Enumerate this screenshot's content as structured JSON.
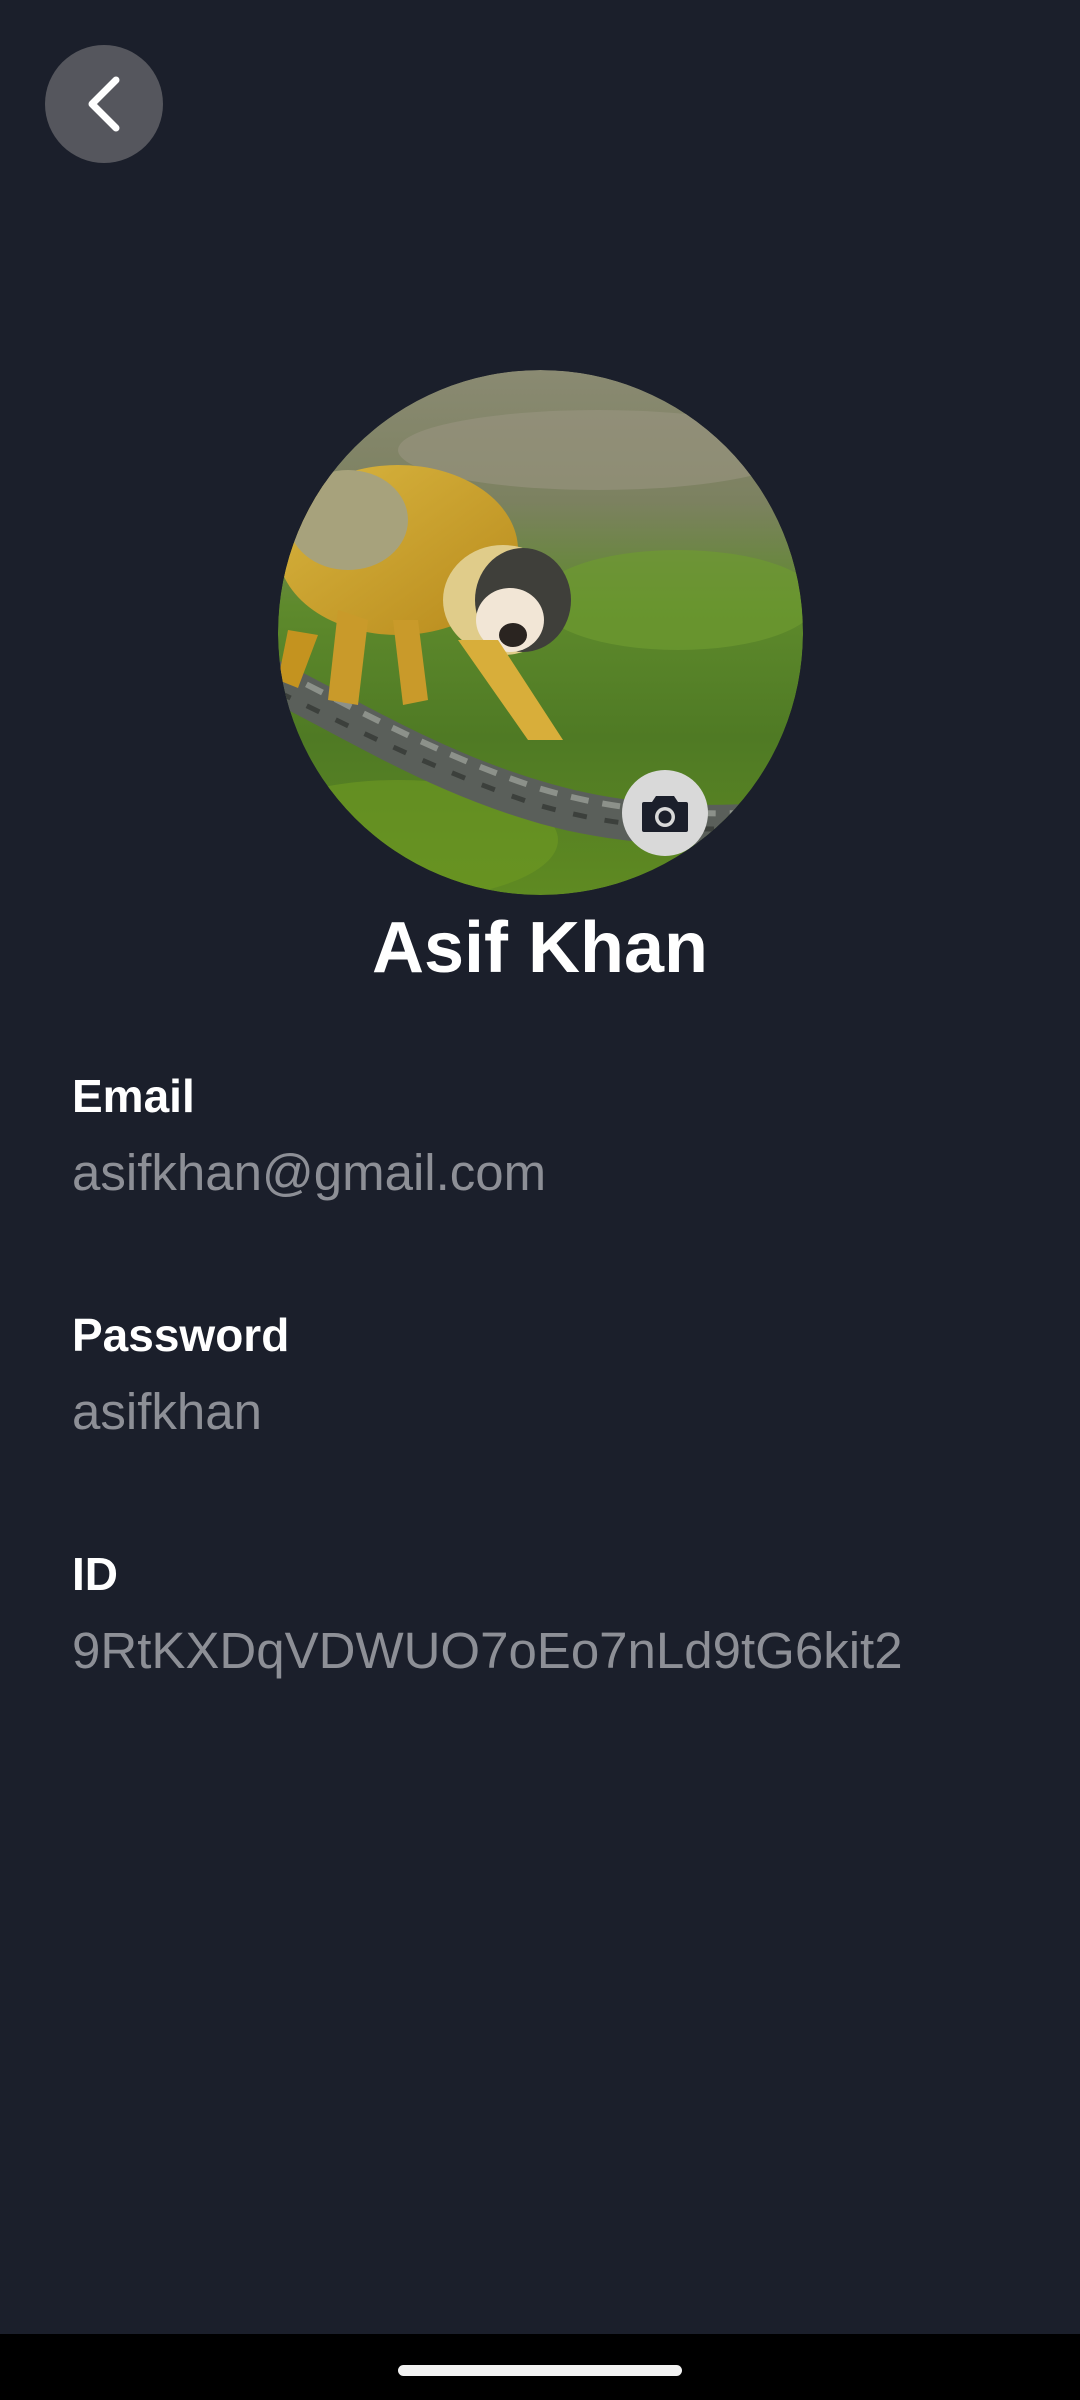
{
  "header": {
    "back_icon": "chevron-left-icon"
  },
  "profile": {
    "avatar_icon": "avatar-photo",
    "camera_icon": "camera-icon",
    "name": "Asif Khan"
  },
  "fields": [
    {
      "label": "Email",
      "value": "asifkhan@gmail.com"
    },
    {
      "label": "Password",
      "value": "asifkhan"
    },
    {
      "label": "ID",
      "value": "9RtKXDqVDWUO7oEo7nLd9tG6kit2"
    }
  ],
  "colors": {
    "background": "#1b1f2b",
    "label": "#ffffff",
    "value": "#8d8f96",
    "back_button": "#55565d"
  }
}
